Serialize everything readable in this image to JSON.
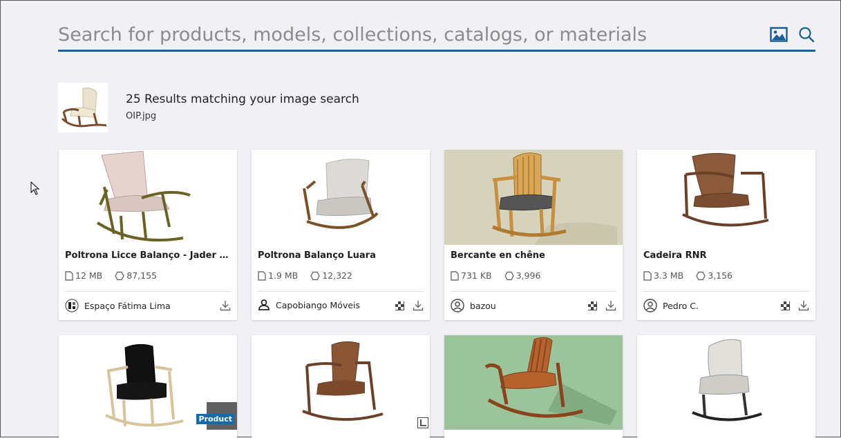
{
  "search": {
    "placeholder": "Search for products, models, collections, catalogs, or materials"
  },
  "icons": {
    "image_search": "image-icon",
    "search": "magnifier-icon",
    "file": "file-icon",
    "polygons": "hexagon-icon",
    "download": "download-icon",
    "texture": "checker-icon"
  },
  "colors": {
    "accent": "#1a5f96",
    "product_badge": "#1a6aa8",
    "background": "#f1f0f5"
  },
  "query": {
    "title": "25 Results matching your image search",
    "file": "OIP.jpg"
  },
  "results": [
    {
      "title": "Poltrona Licce Balanço - Jader Almei...",
      "size": "12 MB",
      "polys": "87,155",
      "author": "Espaço Fátima Lima"
    },
    {
      "title": "Poltrona Balanço Luara",
      "size": "1.9 MB",
      "polys": "12,322",
      "author": "Capobiango Móveis"
    },
    {
      "title": "Bercante en chêne",
      "size": "731 KB",
      "polys": "3,996",
      "author": "bazou"
    },
    {
      "title": "Cadeira RNR",
      "size": "3.3 MB",
      "polys": "3,156",
      "author": "Pedro C."
    }
  ],
  "row2": {
    "badge": "Product"
  }
}
